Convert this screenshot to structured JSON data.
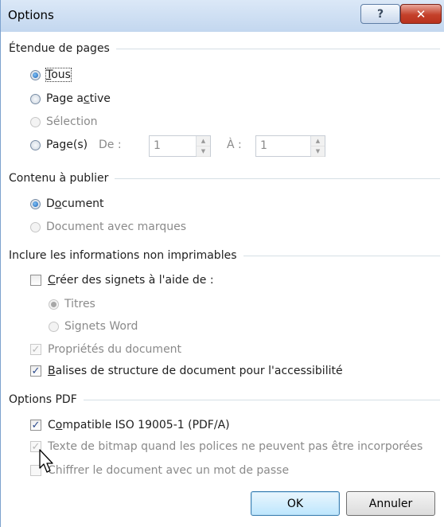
{
  "window": {
    "title": "Options",
    "help_label": "?",
    "close_label": "✕"
  },
  "page_range": {
    "title": "Étendue de pages",
    "options": [
      {
        "pre": "",
        "mn": "T",
        "post": "ous",
        "checked": true,
        "disabled": false
      },
      {
        "pre": "Page a",
        "mn": "c",
        "post": "tive",
        "checked": false,
        "disabled": false
      },
      {
        "pre": "Sélection",
        "mn": "",
        "post": "",
        "checked": false,
        "disabled": true
      },
      {
        "pre": "Pa",
        "mn": "g",
        "post": "e(s)",
        "checked": false,
        "disabled": false
      }
    ],
    "from_label": "De :",
    "from_value": "1",
    "to_label": "À :",
    "to_value": "1"
  },
  "publish": {
    "title": "Contenu à publier",
    "options": [
      {
        "pre": "D",
        "mn": "o",
        "post": "cument",
        "checked": true,
        "disabled": false
      },
      {
        "pre": "Document avec marques",
        "mn": "",
        "post": "",
        "checked": false,
        "disabled": true
      }
    ]
  },
  "nonprint": {
    "title": "Inclure les informations non imprimables",
    "create_bookmarks": {
      "pre": "",
      "mn": "C",
      "post": "réer des signets à l'aide de :",
      "checked": false,
      "disabled": false
    },
    "bookmark_options": [
      {
        "label": "Titres",
        "checked": true,
        "disabled": true
      },
      {
        "label": "Signets Word",
        "checked": false,
        "disabled": true
      }
    ],
    "doc_properties": {
      "label": "Propriétés du document",
      "checked": true,
      "disabled": true
    },
    "structure_tags": {
      "pre": "",
      "mn": "B",
      "post": "alises de structure de document pour l'accessibilité",
      "checked": true,
      "disabled": false
    }
  },
  "pdf": {
    "title": "Options PDF",
    "iso": {
      "pre": "C",
      "mn": "o",
      "post": "mpatible ISO 19005-1 (PDF/A)",
      "checked": true,
      "disabled": false
    },
    "bitmap_text": {
      "label": "Texte de bitmap quand les polices ne peuvent pas être incorporées",
      "checked": true,
      "disabled": true
    },
    "encrypt": {
      "label": "Chiffrer le document avec un mot de passe",
      "checked": false,
      "disabled": true
    }
  },
  "buttons": {
    "ok": "OK",
    "cancel": "Annuler"
  }
}
